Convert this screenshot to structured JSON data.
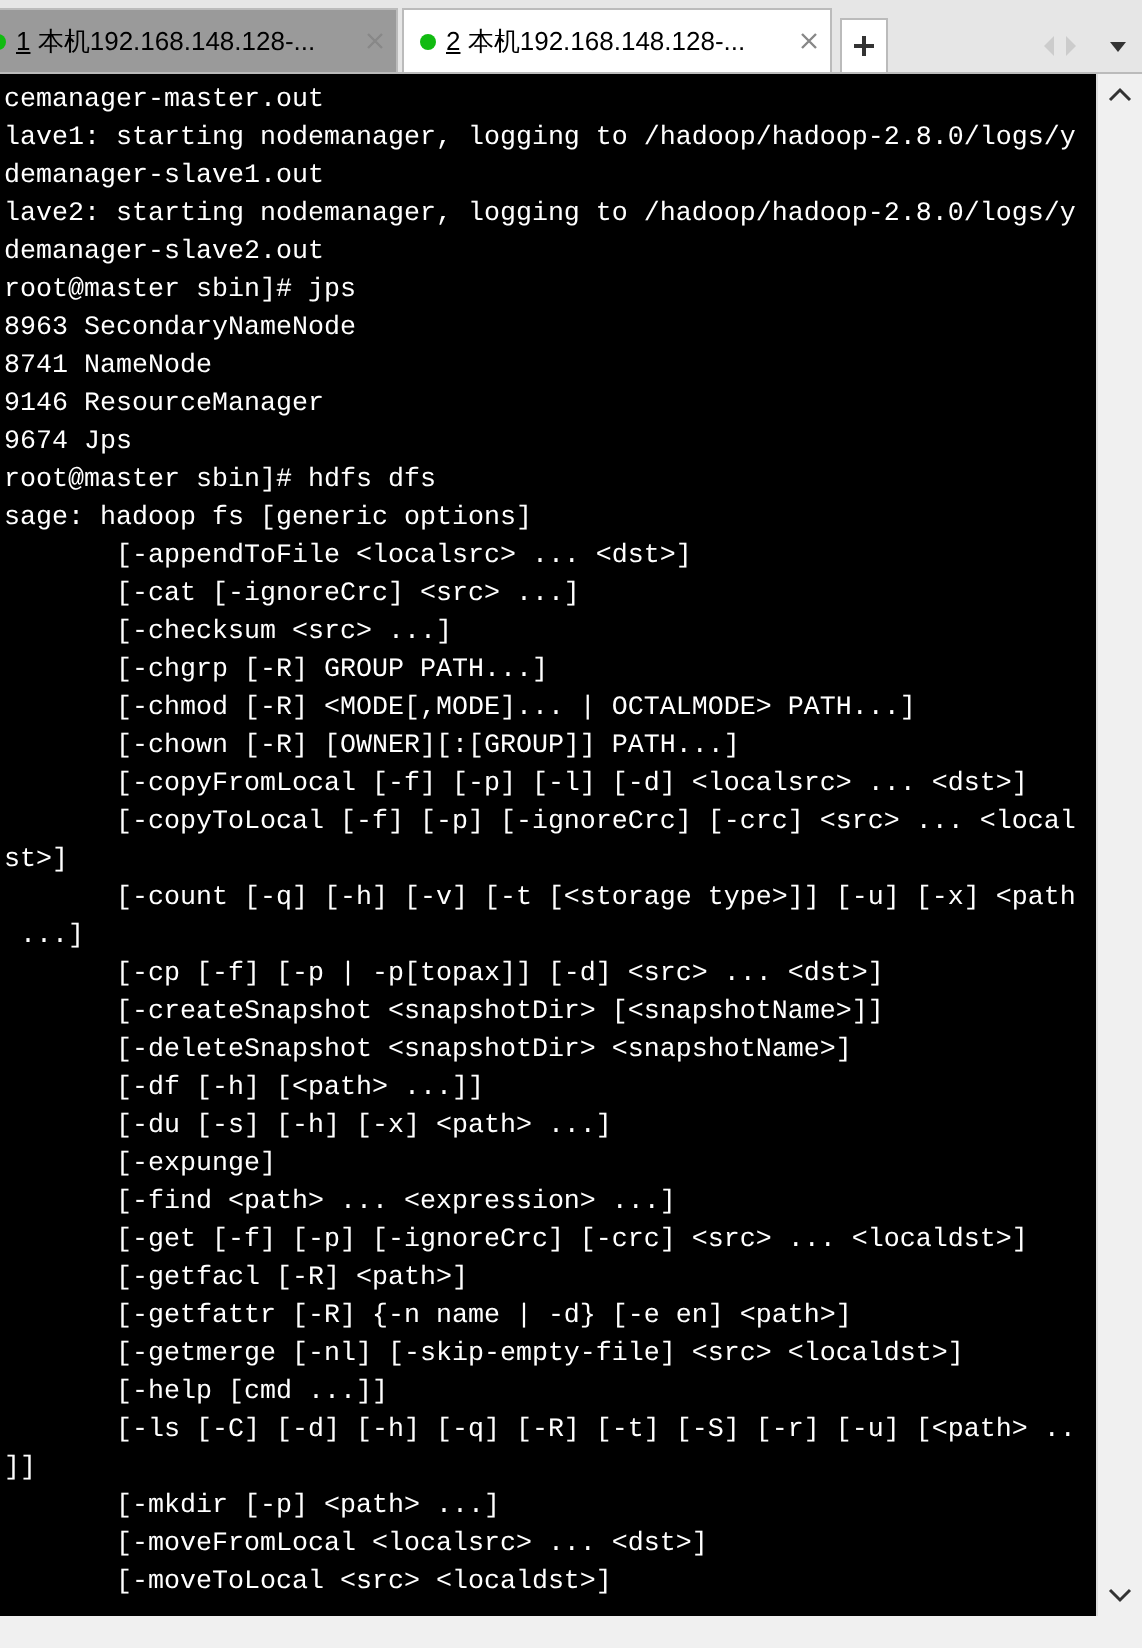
{
  "tabs": [
    {
      "number": "1",
      "title": "本机192.168.148.128-...",
      "selected": false
    },
    {
      "number": "2",
      "title": "本机192.168.148.128-...",
      "selected": true
    }
  ],
  "terminal": {
    "lines": [
      "cemanager-master.out",
      "lave1: starting nodemanager, logging to /hadoop/hadoop-2.8.0/logs/y",
      "demanager-slave1.out",
      "lave2: starting nodemanager, logging to /hadoop/hadoop-2.8.0/logs/y",
      "demanager-slave2.out",
      "root@master sbin]# jps",
      "8963 SecondaryNameNode",
      "8741 NameNode",
      "9146 ResourceManager",
      "9674 Jps",
      "root@master sbin]# hdfs dfs",
      "sage: hadoop fs [generic options]",
      "       [-appendToFile <localsrc> ... <dst>]",
      "       [-cat [-ignoreCrc] <src> ...]",
      "       [-checksum <src> ...]",
      "       [-chgrp [-R] GROUP PATH...]",
      "       [-chmod [-R] <MODE[,MODE]... | OCTALMODE> PATH...]",
      "       [-chown [-R] [OWNER][:[GROUP]] PATH...]",
      "       [-copyFromLocal [-f] [-p] [-l] [-d] <localsrc> ... <dst>]",
      "       [-copyToLocal [-f] [-p] [-ignoreCrc] [-crc] <src> ... <local",
      "st>]",
      "       [-count [-q] [-h] [-v] [-t [<storage type>]] [-u] [-x] <path",
      " ...]",
      "       [-cp [-f] [-p | -p[topax]] [-d] <src> ... <dst>]",
      "       [-createSnapshot <snapshotDir> [<snapshotName>]]",
      "       [-deleteSnapshot <snapshotDir> <snapshotName>]",
      "       [-df [-h] [<path> ...]]",
      "       [-du [-s] [-h] [-x] <path> ...]",
      "       [-expunge]",
      "       [-find <path> ... <expression> ...]",
      "       [-get [-f] [-p] [-ignoreCrc] [-crc] <src> ... <localdst>]",
      "       [-getfacl [-R] <path>]",
      "       [-getfattr [-R] {-n name | -d} [-e en] <path>]",
      "       [-getmerge [-nl] [-skip-empty-file] <src> <localdst>]",
      "       [-help [cmd ...]]",
      "       [-ls [-C] [-d] [-h] [-q] [-R] [-t] [-S] [-r] [-u] [<path> ..",
      "]]",
      "       [-mkdir [-p] <path> ...]",
      "       [-moveFromLocal <localsrc> ... <dst>]",
      "       [-moveToLocal <src> <localdst>]"
    ]
  }
}
